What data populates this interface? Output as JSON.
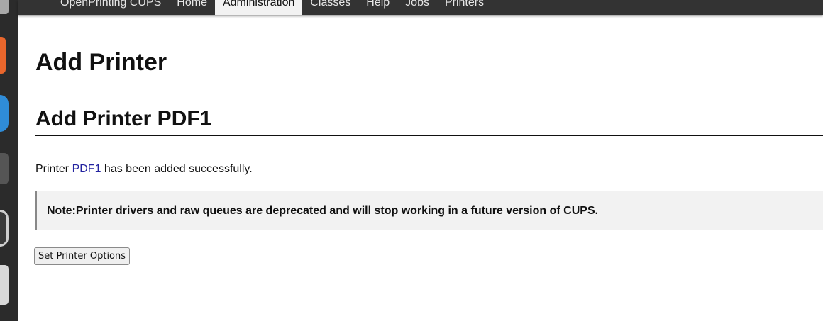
{
  "dock": {
    "items": [
      "app-icon",
      "app-icon",
      "app-icon",
      "app-icon",
      "app-icon",
      "app-icon"
    ]
  },
  "nav": {
    "items": [
      "OpenPrinting CUPS",
      "Home",
      "Administration",
      "Classes",
      "Help",
      "Jobs",
      "Printers"
    ],
    "active": "Administration"
  },
  "page": {
    "title": "Add Printer",
    "subtitle": "Add Printer PDF1"
  },
  "message": {
    "prefix": "Printer ",
    "printer_link": "PDF1",
    "suffix": " has been added successfully."
  },
  "note": {
    "text": "Note:Printer drivers and raw queues are deprecated and will stop working in a future version of CUPS."
  },
  "actions": {
    "set_options_label": "Set Printer Options"
  },
  "colors": {
    "nav_bg": "#333333",
    "link": "#2323a0",
    "note_bg": "#f2f2f2"
  }
}
